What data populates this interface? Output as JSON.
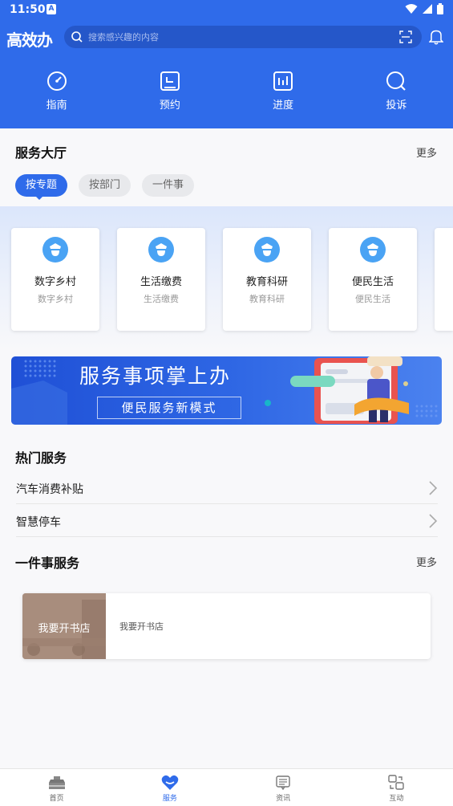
{
  "status_bar": {
    "time": "11:50",
    "notif_glyph": "A"
  },
  "header": {
    "logo": "高效办",
    "search_placeholder": "搜索感兴趣的内容"
  },
  "quick_nav": [
    {
      "label": "指南",
      "icon": "compass-icon"
    },
    {
      "label": "预约",
      "icon": "calendar-icon"
    },
    {
      "label": "进度",
      "icon": "progress-chart-icon"
    },
    {
      "label": "投诉",
      "icon": "search-icon"
    }
  ],
  "service_hall": {
    "title": "服务大厅",
    "more": "更多",
    "chips": [
      "按专题",
      "按部门",
      "一件事"
    ],
    "cards": [
      {
        "title": "数字乡村",
        "subtitle": "数字乡村"
      },
      {
        "title": "生活缴费",
        "subtitle": "生活缴费"
      },
      {
        "title": "教育科研",
        "subtitle": "教育科研"
      },
      {
        "title": "便民生活",
        "subtitle": "便民生活"
      }
    ]
  },
  "banner": {
    "title": "服务事项掌上办",
    "subtitle": "便民服务新模式"
  },
  "hot_services": {
    "title": "热门服务",
    "items": [
      "汽车消费补贴",
      "智慧停车"
    ]
  },
  "one_thing": {
    "title": "一件事服务",
    "more": "更多",
    "card": {
      "image_label": "我要开书店",
      "description": "我要开书店"
    }
  },
  "tabbar": [
    {
      "label": "首页",
      "icon": "home-icon",
      "active": false
    },
    {
      "label": "服务",
      "icon": "heart-icon",
      "active": true
    },
    {
      "label": "资讯",
      "icon": "news-icon",
      "active": false
    },
    {
      "label": "互动",
      "icon": "interact-icon",
      "active": false
    }
  ],
  "colors": {
    "primary": "#2f6bea",
    "background": "#f8f8fa"
  }
}
